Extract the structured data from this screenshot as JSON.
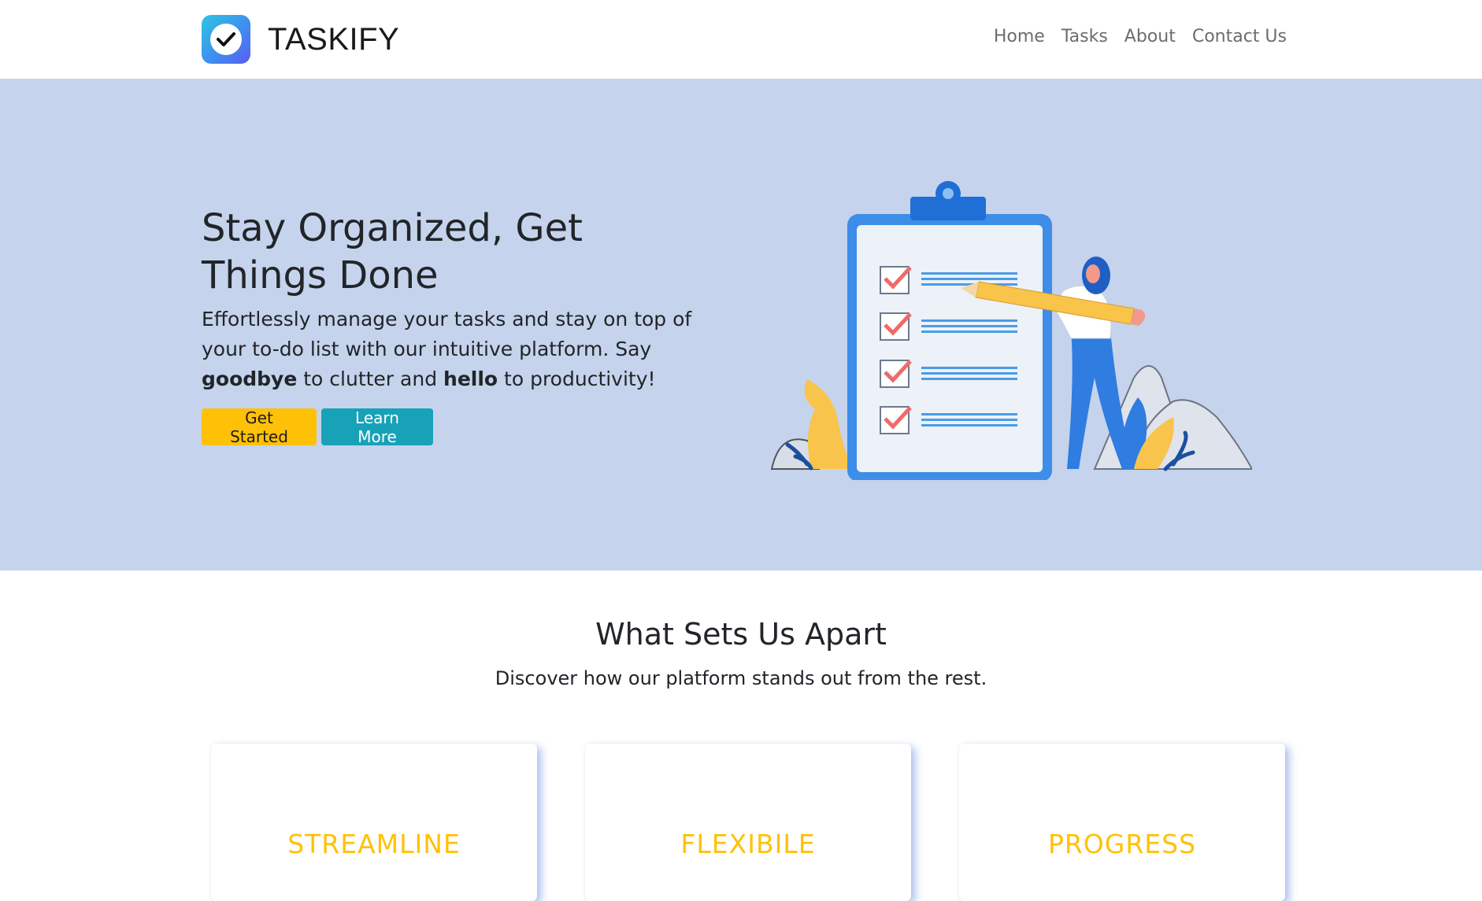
{
  "brand": {
    "name": "TASKIFY",
    "logo_icon": "check-circle-icon"
  },
  "nav": {
    "links": [
      {
        "label": "Home"
      },
      {
        "label": "Tasks"
      },
      {
        "label": "About"
      },
      {
        "label": "Contact Us"
      }
    ]
  },
  "hero": {
    "title": "Stay Organized, Get Things Done",
    "subtitle_part1": "Effortlessly manage your tasks and stay on top of your to-do list with our intuitive platform. Say ",
    "subtitle_bold1": "goodbye",
    "subtitle_part2": " to clutter and ",
    "subtitle_bold2": "hello",
    "subtitle_part3": " to productivity!",
    "get_started_label": "Get Started",
    "learn_more_label": "Learn More",
    "illustration": "checklist-clipboard-illustration"
  },
  "features": {
    "title": "What Sets Us Apart",
    "subtitle": "Discover how our platform stands out from the rest.",
    "cards": [
      {
        "title": "STREAMLINE"
      },
      {
        "title": "FLEXIBILE"
      },
      {
        "title": "PROGRESS"
      }
    ]
  },
  "colors": {
    "hero_bg": "#c5d3ec",
    "accent_yellow": "#ffc107",
    "accent_teal": "#17a2b8",
    "brand_blue": "#3f8ef0"
  }
}
